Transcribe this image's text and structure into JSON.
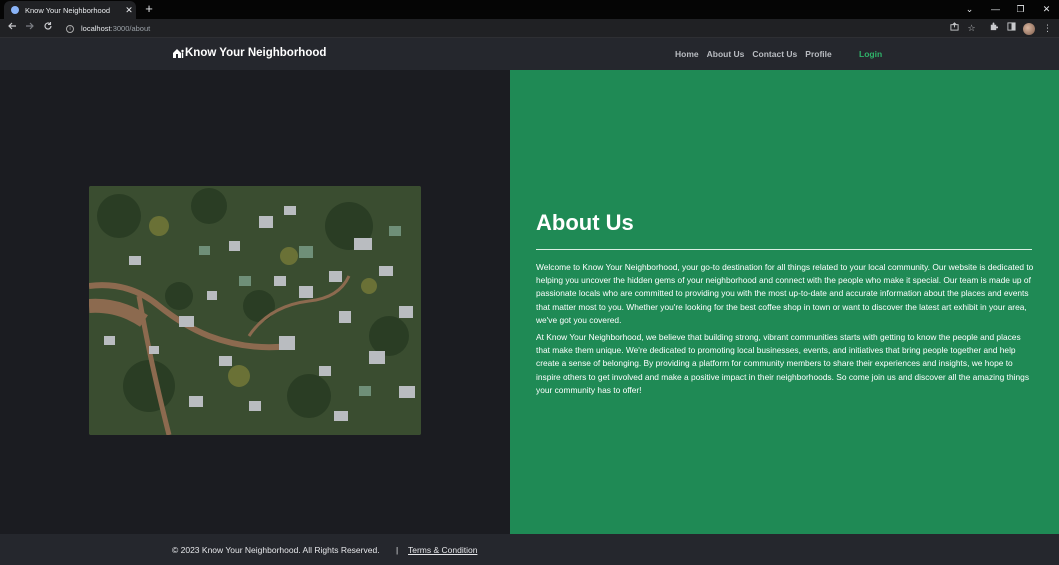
{
  "browser": {
    "tab_title": "Know Your Neighborhood",
    "tab_close": "✕",
    "new_tab": "+",
    "url_host": "localhost",
    "url_path": ":3000/about",
    "window_controls": [
      "⌄",
      "—",
      "❐",
      "✕"
    ]
  },
  "navbar": {
    "brand": "Know Your Neighborhood",
    "links": [
      "Home",
      "About Us",
      "Contact Us",
      "Profile"
    ],
    "login": "Login"
  },
  "about": {
    "title": "About Us",
    "paragraphs": [
      "Welcome to Know Your Neighborhood, your go-to destination for all things related to your local community. Our website is dedicated to helping you uncover the hidden gems of your neighborhood and connect with the people who make it special. Our team is made up of passionate locals who are committed to providing you with the most up-to-date and accurate information about the places and events that matter most to you. Whether you're looking for the best coffee shop in town or want to discover the latest art exhibit in your area, we've got you covered.",
      "At Know Your Neighborhood, we believe that building strong, vibrant communities starts with getting to know the people and places that make them unique. We're dedicated to promoting local businesses, events, and initiatives that bring people together and help create a sense of belonging. By providing a platform for community members to share their experiences and insights, we hope to inspire others to get involved and make a positive impact in their neighborhoods. So come join us and discover all the amazing things your community has to offer!"
    ]
  },
  "footer": {
    "copyright": "© 2023 Know Your Neighborhood. All Rights Reserved.",
    "separator": "|",
    "terms": "Terms & Condition"
  },
  "colors": {
    "accent_green": "#1f8a55",
    "login_green": "#2fb36a",
    "navbar_bg": "#25272d",
    "page_bg": "#1b1c21"
  }
}
